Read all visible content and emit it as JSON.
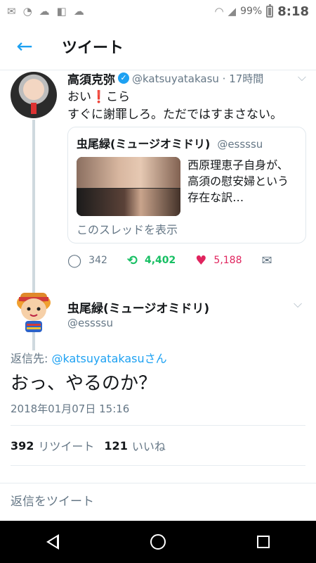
{
  "status_bar": {
    "battery": "99%",
    "time": "8:18"
  },
  "header": {
    "title": "ツイート"
  },
  "original_tweet": {
    "name": "高須克弥",
    "handle": "@katsuyatakasu · 17時間",
    "line1_a": "おい",
    "line1_b": "こら",
    "line2": "すぐに謝罪しろ。ただではすまさない。",
    "quote": {
      "name": "虫尾緑(ミュージオミドリ)",
      "handle": "@essssu",
      "text": "西原理恵子自身が、高須の慰安婦という存在な訳…",
      "show_thread": "このスレッドを表示"
    },
    "actions": {
      "replies": "342",
      "retweets": "4,402",
      "likes": "5,188"
    }
  },
  "reply_tweet": {
    "name": "虫尾緑(ミュージオミドリ)",
    "handle": "@essssu",
    "replying_prefix": "返信先: ",
    "replying_mention": "@katsuyatakasuさん",
    "text": "おっ、やるのか？",
    "timestamp": "2018年01月07日 15:16",
    "retweet_count": "392",
    "retweet_label": "リツイート",
    "like_count": "121",
    "like_label": "いいね"
  },
  "reply_input": {
    "placeholder": "返信をツイート"
  },
  "colors": {
    "accent": "#1da1f2",
    "retweet": "#17bf63",
    "like": "#e0245e"
  }
}
